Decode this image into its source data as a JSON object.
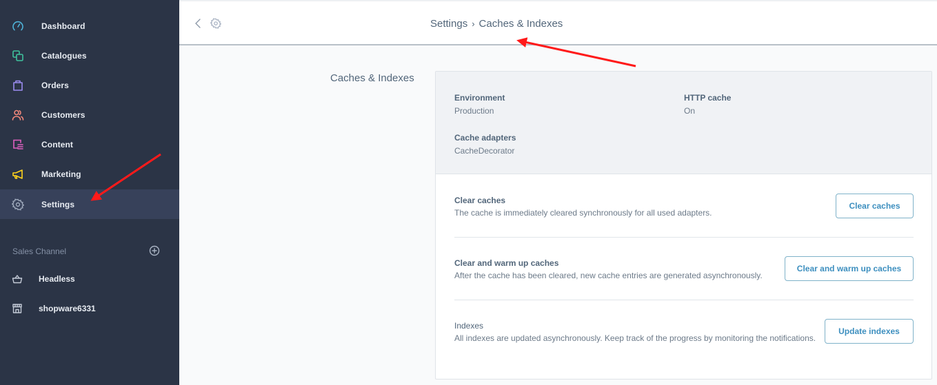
{
  "sidebar": {
    "items": [
      {
        "label": "Dashboard",
        "icon": "dashboard-gauge-icon",
        "color": "#4fb3d9"
      },
      {
        "label": "Catalogues",
        "icon": "catalogues-squares-icon",
        "color": "#3fc29e"
      },
      {
        "label": "Orders",
        "icon": "orders-bag-icon",
        "color": "#9b8cf0"
      },
      {
        "label": "Customers",
        "icon": "customers-users-icon",
        "color": "#f0877a"
      },
      {
        "label": "Content",
        "icon": "content-layout-icon",
        "color": "#e060c0"
      },
      {
        "label": "Marketing",
        "icon": "marketing-megaphone-icon",
        "color": "#ffd21c"
      },
      {
        "label": "Settings",
        "icon": "settings-gear-icon",
        "color": "#a0abbd",
        "active": true
      }
    ],
    "sales_channel": {
      "header": "Sales Channel",
      "add_icon": "plus-circle-icon",
      "items": [
        {
          "label": "Headless",
          "icon": "basket-icon"
        },
        {
          "label": "shopware6331",
          "icon": "storefront-icon"
        }
      ]
    }
  },
  "topbar": {
    "back_icon": "chevron-left-icon",
    "module_icon": "gear-icon",
    "breadcrumb": {
      "parent": "Settings",
      "separator": "›",
      "current": "Caches & Indexes"
    }
  },
  "main": {
    "section_title": "Caches & Indexes",
    "info": {
      "environment": {
        "label": "Environment",
        "value": "Production"
      },
      "http_cache": {
        "label": "HTTP cache",
        "value": "On"
      },
      "cache_adapters": {
        "label": "Cache adapters",
        "value": "CacheDecorator"
      }
    },
    "actions": [
      {
        "title": "Clear caches",
        "description": "The cache is immediately cleared synchronously for all used adapters.",
        "button": "Clear caches"
      },
      {
        "title": "Clear and warm up caches",
        "description": "After the cache has been cleared, new cache entries are generated asynchronously.",
        "button": "Clear and warm up caches"
      },
      {
        "title": "Indexes",
        "description": "All indexes are updated asynchronously. Keep track of the progress by monitoring the notifications.",
        "button": "Update indexes"
      }
    ]
  },
  "colors": {
    "sidebar_bg": "#2b3446",
    "accent": "#3d8fbf",
    "annotation": "#ff1a1a"
  }
}
